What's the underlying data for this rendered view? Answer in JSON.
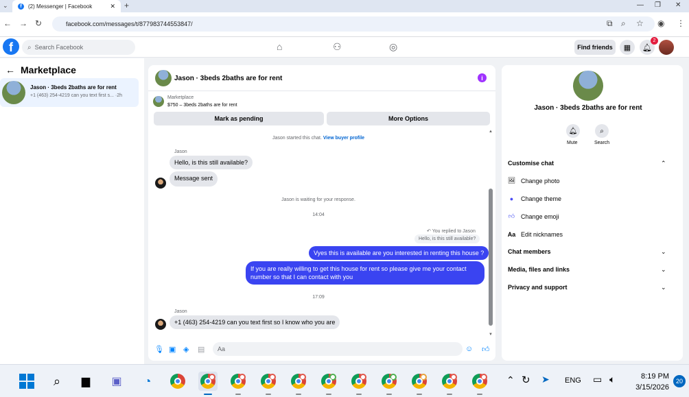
{
  "browser": {
    "tab_title": "(2) Messenger | Facebook",
    "url": "facebook.com/messages/t/877983744553847/"
  },
  "header": {
    "search_placeholder": "Search Facebook",
    "find_friends": "Find friends",
    "notification_count": "2"
  },
  "sidebar": {
    "title": "Marketplace",
    "conversation": {
      "name": "Jason · 3beds 2baths are for rent",
      "snippet": "+1 (463) 254-4219 can you text first s... ·2h"
    }
  },
  "chat": {
    "title": "Jason · 3beds 2baths are for rent",
    "listing_label": "Marketplace",
    "listing_price": "$750 – 3beds 2baths are for rent",
    "mark_pending": "Mark as pending",
    "more_options": "More Options",
    "started_text": "Jason started this chat.",
    "view_profile": "View buyer profile",
    "sender1": "Jason",
    "msg1": "Hello, is this still available?",
    "msg2": "Message sent",
    "waiting": "Jason is waiting for your response.",
    "time1": "14:04",
    "replied_to": "You replied to Jason",
    "quoted": "Hello, is this still available?",
    "out1": "Vyes this is available are you interested in renting this house ?",
    "out2": "If you are really willing to get this house for rent so please give me your contact number so that I  can contact with you",
    "time2": "17:09",
    "sender2": "Jason",
    "msg3": "+1 (463) 254-4219 can you text first so I know who you are",
    "composer_placeholder": "Aa"
  },
  "details": {
    "name": "Jason · 3beds 2baths are for rent",
    "mute": "Mute",
    "search": "Search",
    "customise": "Customise chat",
    "change_photo": "Change photo",
    "change_theme": "Change theme",
    "change_emoji": "Change emoji",
    "edit_nicknames": "Edit nicknames",
    "chat_members": "Chat members",
    "media": "Media, files and links",
    "privacy": "Privacy and support"
  },
  "taskbar": {
    "lang": "ENG",
    "time": "8:19 PM",
    "date": "3/15/2026",
    "notifications": "20"
  },
  "colors": {
    "accent": "#1877f2",
    "outgoing_bubble": "#3a44f1"
  }
}
